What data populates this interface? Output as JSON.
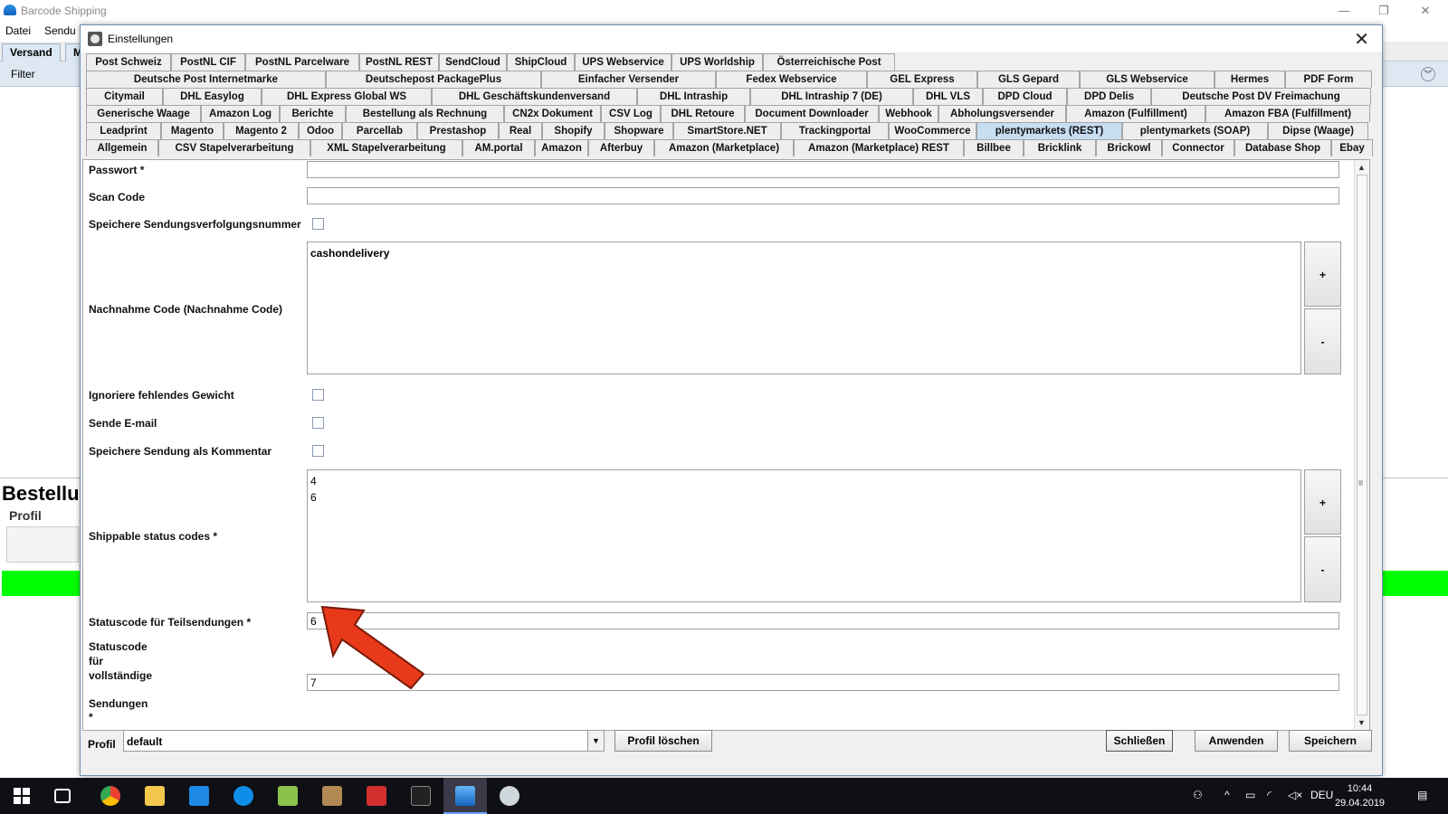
{
  "background_app": {
    "title": "Barcode Shipping",
    "menu": [
      "Datei",
      "Sendu"
    ],
    "tabs": [
      "Versand",
      "M"
    ],
    "filter_label": "Filter",
    "heading": "Bestellu",
    "profil_label": "Profil",
    "status_color": "#00ff00",
    "window_buttons": [
      "—",
      "❐",
      "✕"
    ]
  },
  "dialog": {
    "title": "Einstellungen",
    "close_glyph": "✕",
    "tab_rows": [
      [
        "Post Schweiz",
        "PostNL CIF",
        "PostNL Parcelware",
        "PostNL REST",
        "SendCloud",
        "ShipCloud",
        "UPS Webservice",
        "UPS Worldship",
        "Österreichische Post"
      ],
      [
        "Deutsche Post Internetmarke",
        "Deutschepost PackagePlus",
        "Einfacher Versender",
        "Fedex Webservice",
        "GEL Express",
        "GLS Gepard",
        "GLS Webservice",
        "Hermes",
        "PDF Form"
      ],
      [
        "Citymail",
        "DHL Easylog",
        "DHL Express Global WS",
        "DHL Geschäftskundenversand",
        "DHL Intraship",
        "DHL Intraship 7 (DE)",
        "DHL VLS",
        "DPD Cloud",
        "DPD Delis",
        "Deutsche Post DV Freimachung"
      ],
      [
        "Generische Waage",
        "Amazon Log",
        "Berichte",
        "Bestellung als Rechnung",
        "CN2x Dokument",
        "CSV Log",
        "DHL Retoure",
        "Document Downloader",
        "Webhook",
        "Abholungsversender",
        "Amazon (Fulfillment)",
        "Amazon FBA (Fulfillment)"
      ],
      [
        "Leadprint",
        "Magento",
        "Magento 2",
        "Odoo",
        "Parcellab",
        "Prestashop",
        "Real",
        "Shopify",
        "Shopware",
        "SmartStore.NET",
        "Trackingportal",
        "WooCommerce",
        "plentymarkets (REST)",
        "plentymarkets (SOAP)",
        "Dipse (Waage)"
      ],
      [
        "Allgemein",
        "CSV Stapelverarbeitung",
        "XML Stapelverarbeitung",
        "AM.portal",
        "Amazon",
        "Afterbuy",
        "Amazon (Marketplace)",
        "Amazon (Marketplace) REST",
        "Billbee",
        "Bricklink",
        "Brickowl",
        "Connector",
        "Database Shop",
        "Ebay"
      ]
    ],
    "active_tab": "plentymarkets (REST)",
    "active_tab_color": "#c7ddf2",
    "form": {
      "passwort_label": "Passwort *",
      "passwort_value": "",
      "scan_code_label": "Scan Code",
      "scan_code_value": "",
      "speichere_tracking_label": "Speichere Sendungsverfolgungsnummer",
      "speichere_tracking_checked": false,
      "nachnahme_label": "Nachnahme Code (Nachnahme Code)",
      "nachnahme_values": [
        "cashondelivery"
      ],
      "ignoriere_gewicht_label": "Ignoriere fehlendes Gewicht",
      "ignoriere_gewicht_checked": false,
      "sende_email_label": "Sende E-mail",
      "sende_email_checked": false,
      "speichere_kommentar_label": "Speichere Sendung als Kommentar",
      "speichere_kommentar_checked": false,
      "shippable_label": "Shippable status codes *",
      "shippable_values": [
        "4",
        "6"
      ],
      "teilsendungen_label": "Statuscode für Teilsendungen *",
      "teilsendungen_value": "6",
      "vollstaendige_label_lines": [
        "Statuscode",
        "für",
        "vollständige"
      ],
      "vollstaendige_value": "7",
      "sendungen_label_lines": [
        "Sendungen",
        "*"
      ],
      "add_button": "+",
      "remove_button": "-"
    },
    "footer": {
      "profil_label": "Profil",
      "profil_value": "default",
      "profil_loeschen": "Profil löschen",
      "schliessen": "Schließen",
      "anwenden": "Anwenden",
      "speichern": "Speichern"
    }
  },
  "annotation": {
    "arrow_color": "#e8391a",
    "arrow_outline": "#7a1a08"
  },
  "taskbar": {
    "language": "DEU",
    "time": "10:44",
    "date": "29.04.2019",
    "apps": [
      "windows-start",
      "task-view",
      "chrome",
      "file-explorer",
      "vscode",
      "teamviewer",
      "notepad-plus",
      "package-app",
      "acrobat",
      "terminal",
      "barcode-shipping",
      "paint-tool"
    ]
  }
}
